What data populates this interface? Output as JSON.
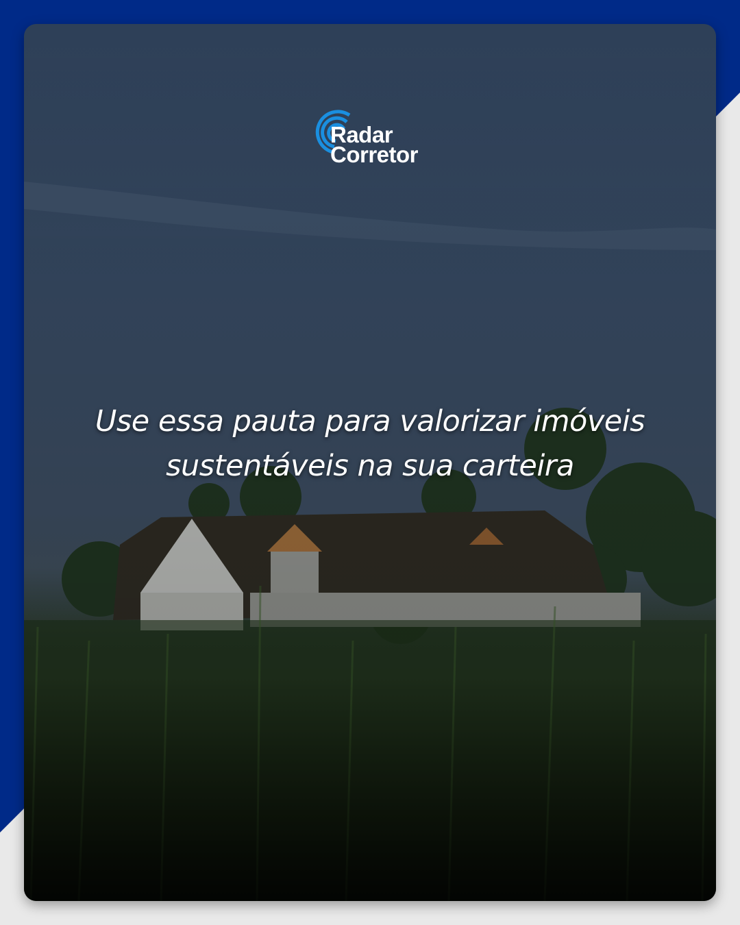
{
  "brand": {
    "name_line1": "Radar",
    "name_line2": "Corretor",
    "accent_color": "#1a8fe0",
    "background_color": "#002a88"
  },
  "post": {
    "headline": "Use essa pauta para valorizar imóveis sustentáveis na sua carteira"
  }
}
